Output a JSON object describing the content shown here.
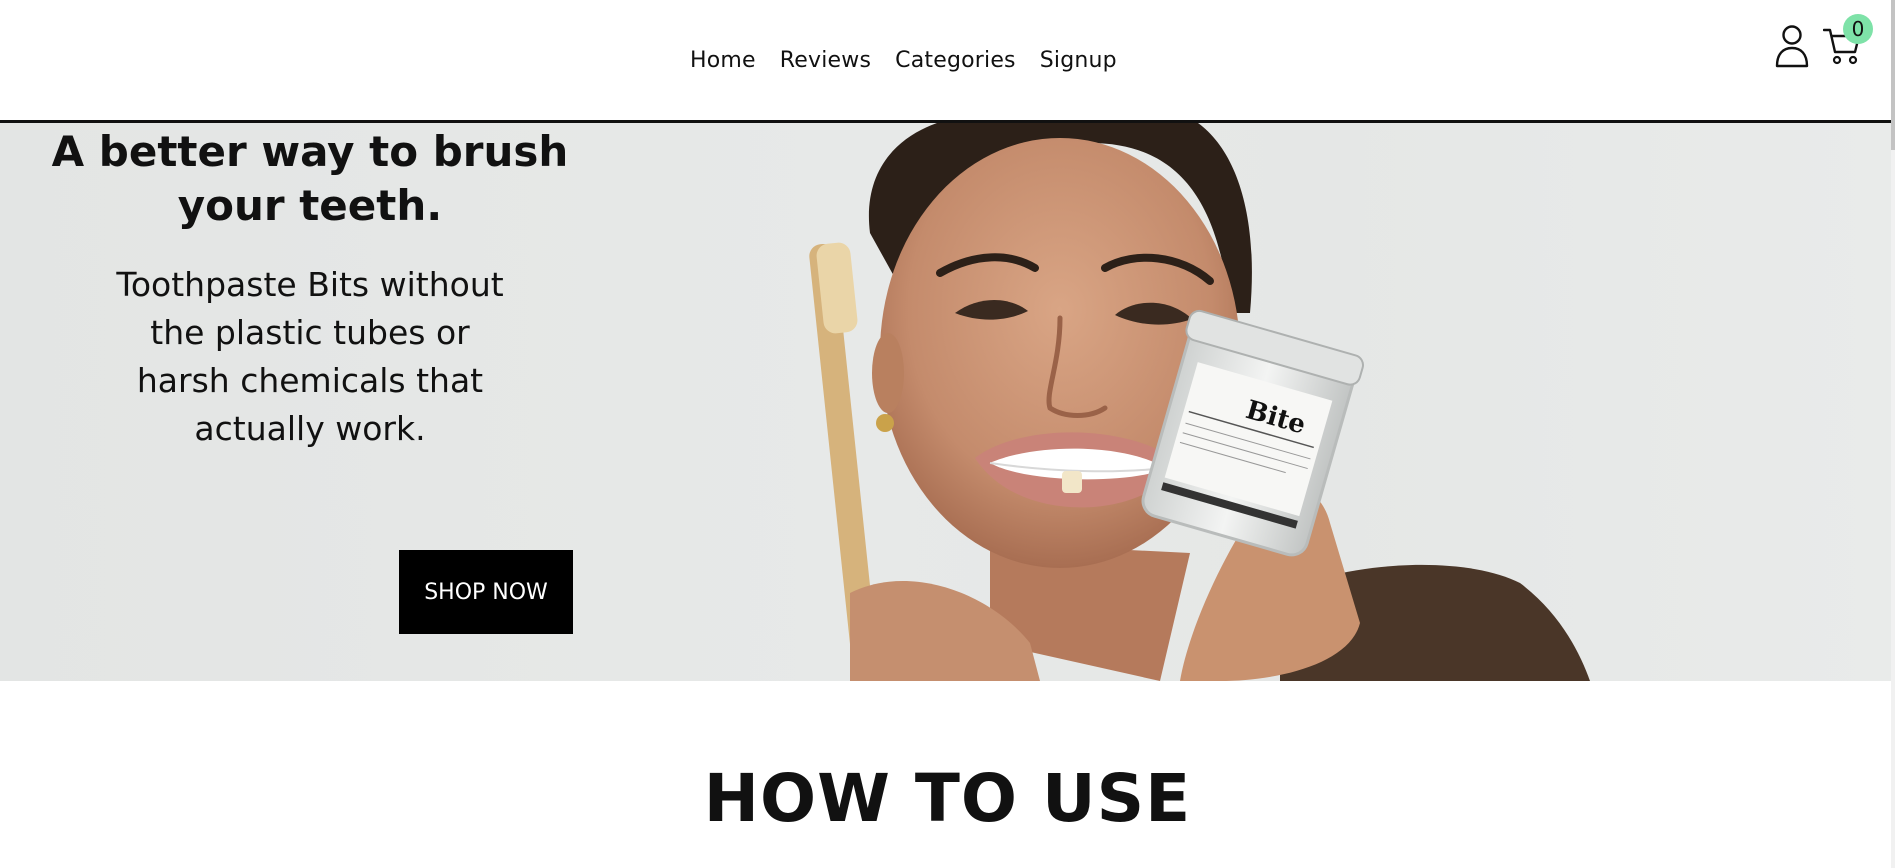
{
  "nav": {
    "items": [
      {
        "label": "Home"
      },
      {
        "label": "Reviews"
      },
      {
        "label": "Categories"
      },
      {
        "label": "Signup"
      }
    ]
  },
  "header": {
    "cart_count": "0",
    "user_icon": "user-icon",
    "cart_icon": "cart-icon"
  },
  "hero": {
    "title": "A better way to brush your teeth.",
    "subtitle": "Toothpaste Bits without the plastic tubes or harsh chemicals that actually work.",
    "button": "SHOP NOW",
    "jar_brand": "Bite"
  },
  "section": {
    "title": "HOW TO USE"
  },
  "colors": {
    "accent_badge": "#7ee2a8",
    "button_bg": "#000000",
    "hero_bg": "#e5e7e6"
  }
}
